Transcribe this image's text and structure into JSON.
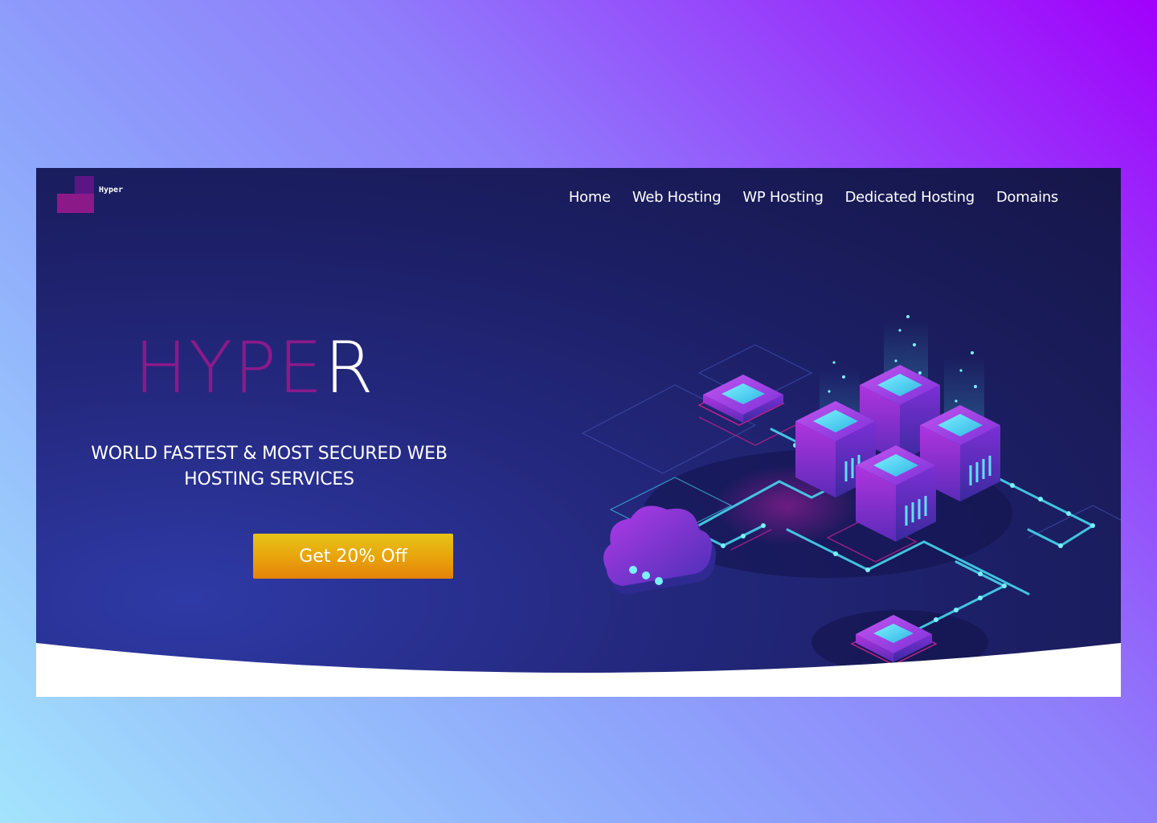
{
  "logo": {
    "text": "Hyper"
  },
  "nav": {
    "items": [
      "Home",
      "Web Hosting",
      "WP Hosting",
      "Dedicated Hosting",
      "Domains"
    ]
  },
  "hero": {
    "brand_main": "HYPE",
    "brand_last": "R",
    "tagline_line1": "WORLD FASTEST & MOST SECURED WEB",
    "tagline_line2": "HOSTING SERVICES",
    "cta_label": "Get 20% Off"
  },
  "colors": {
    "brand_accent": "#8b1a8b",
    "hero_background": "#1b1e62",
    "cta": "#e8a20c",
    "illustration_glow": "#47d6ee",
    "illustration_cube": "#8a22c8"
  },
  "illustration": {
    "icon": "isometric-server-network-illustration"
  }
}
